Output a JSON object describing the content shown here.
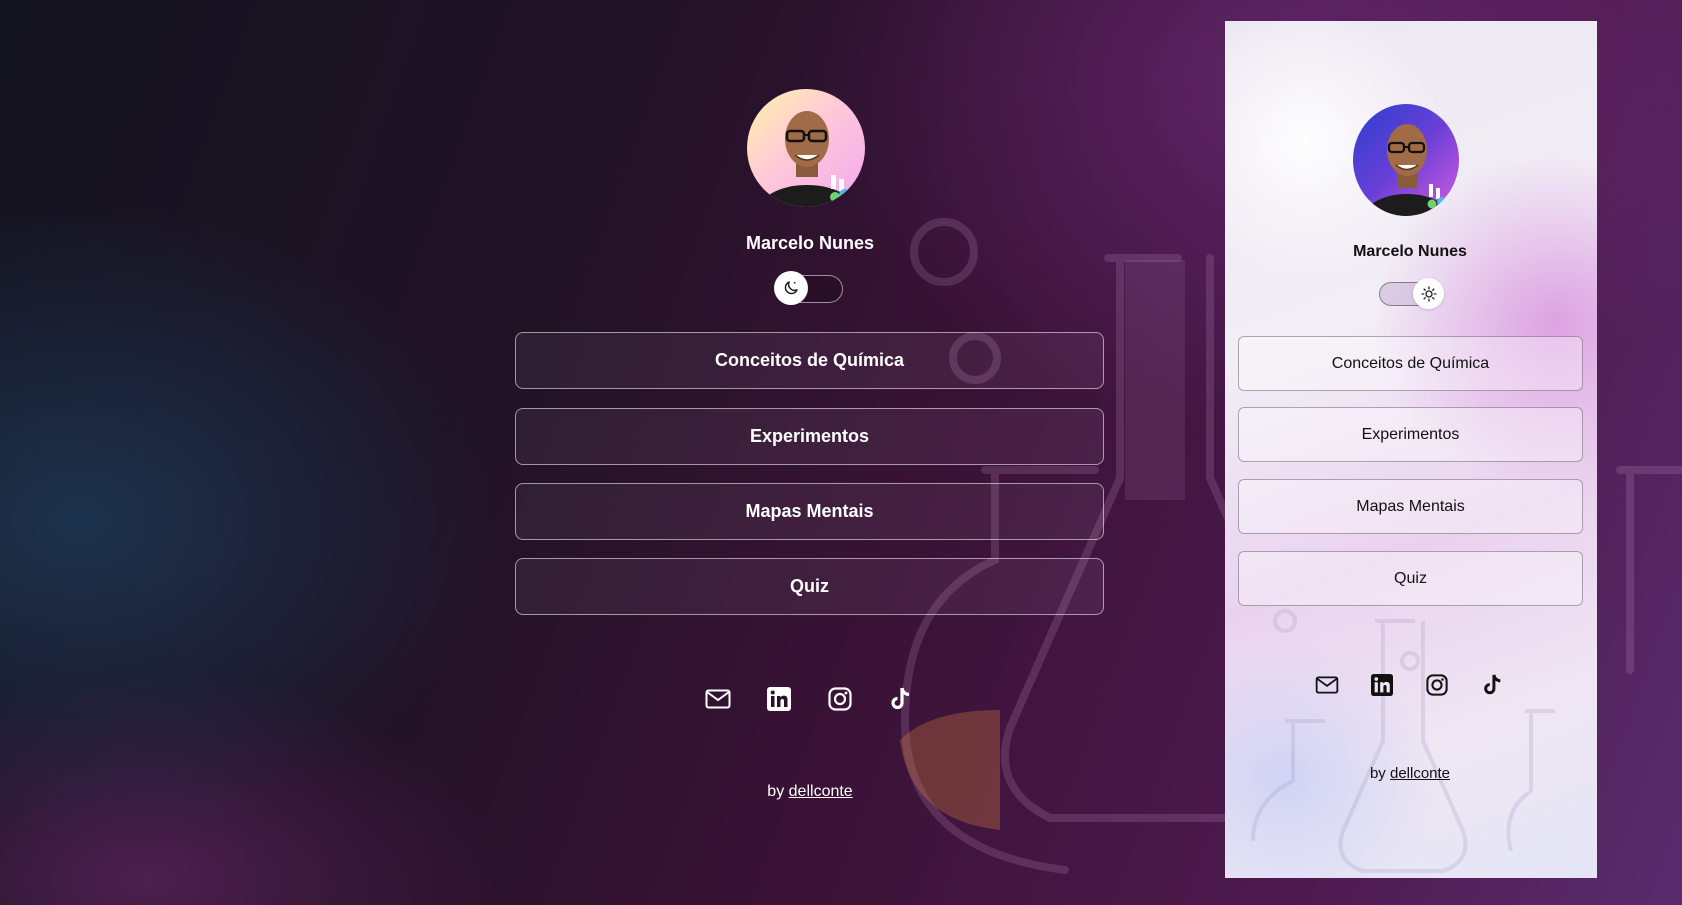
{
  "dark_profile": {
    "name": "Marcelo Nunes",
    "theme_toggle_icon": "moon-icon",
    "links": [
      {
        "label": "Conceitos de Química"
      },
      {
        "label": "Experimentos"
      },
      {
        "label": "Mapas Mentais"
      },
      {
        "label": "Quiz"
      }
    ],
    "social_icons": [
      "mail-icon",
      "linkedin-icon",
      "instagram-icon",
      "tiktok-icon"
    ],
    "credit_prefix": "by",
    "credit_link": "dellconte"
  },
  "light_profile": {
    "name": "Marcelo Nunes",
    "theme_toggle_icon": "sun-icon",
    "links": [
      {
        "label": "Conceitos de Química"
      },
      {
        "label": "Experimentos"
      },
      {
        "label": "Mapas Mentais"
      },
      {
        "label": "Quiz"
      }
    ],
    "social_icons": [
      "mail-icon",
      "linkedin-icon",
      "instagram-icon",
      "tiktok-icon"
    ],
    "credit_prefix": "by",
    "credit_link": "dellconte"
  },
  "colors": {
    "dark_background": "#3a1236",
    "light_panel_background": "#efe6f3",
    "dark_button_border": "#c9a8c4",
    "light_button_border": "#6e6478"
  }
}
